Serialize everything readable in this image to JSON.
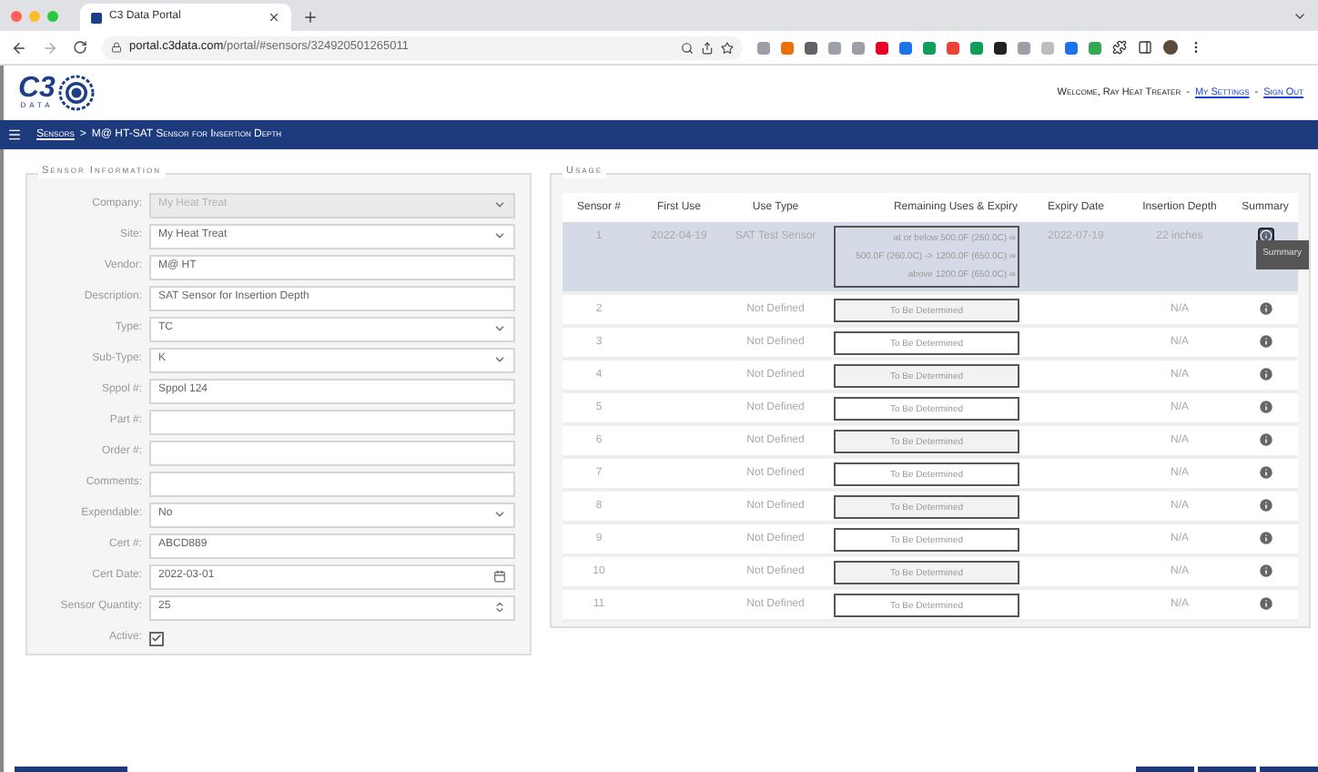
{
  "browser": {
    "tab_title": "C3 Data Portal",
    "url_host": "portal.c3data.com",
    "url_path": "/portal/#sensors/324920501265011"
  },
  "header": {
    "logo_text": "C3",
    "logo_subtext": "DATA",
    "welcome": "Welcome, Ray Heat Treater",
    "separator_1": "-",
    "settings_link": "My Settings",
    "separator_2": "-",
    "signout_link": "Sign Out"
  },
  "nav": {
    "crumb_link": "Sensors",
    "crumb_separator": ">",
    "crumb_current": "M@ HT-SAT Sensor for Insertion Depth"
  },
  "sensor_info": {
    "title": "Sensor Information",
    "fields": [
      {
        "label": "Company:",
        "kind": "select",
        "value": "My Heat Treat",
        "disabled": true
      },
      {
        "label": "Site:",
        "kind": "select",
        "value": "My Heat Treat",
        "disabled": false
      },
      {
        "label": "Vendor:",
        "kind": "text",
        "value": "M@ HT",
        "disabled": false
      },
      {
        "label": "Description:",
        "kind": "text",
        "value": "SAT Sensor for Insertion Depth",
        "disabled": false
      },
      {
        "label": "Type:",
        "kind": "select",
        "value": "TC",
        "disabled": false
      },
      {
        "label": "Sub-Type:",
        "kind": "select",
        "value": "K",
        "disabled": false
      },
      {
        "label": "Sppol #:",
        "kind": "text",
        "value": "Sppol 124",
        "disabled": false
      },
      {
        "label": "Part #:",
        "kind": "text",
        "disabled": false
      },
      {
        "label": "Order #:",
        "kind": "text",
        "disabled": false
      },
      {
        "label": "Comments:",
        "kind": "text",
        "disabled": false
      },
      {
        "label": "Expendable:",
        "kind": "select",
        "value": "No",
        "disabled": false
      },
      {
        "label": "Cert #:",
        "kind": "text",
        "value": "ABCD889",
        "disabled": false
      },
      {
        "label": "Cert Date:",
        "kind": "date",
        "value": "2022-03-01",
        "disabled": false
      },
      {
        "label": "Sensor Quantity:",
        "kind": "number",
        "value": "25",
        "disabled": false
      },
      {
        "label": "Active:",
        "kind": "checkbox",
        "checked": true,
        "disabled": false
      }
    ]
  },
  "usage": {
    "title": "Usage",
    "columns": [
      "Sensor #",
      "First Use",
      "Use Type",
      "Remaining Uses & Expiry",
      "Expiry Date",
      "Insertion Depth",
      "Summary"
    ],
    "rows": [
      {
        "sensor": "1",
        "first_use": "2022-04-19",
        "use_type": "SAT Test Sensor",
        "remaining": [
          "at or below 500.0F (260.0C) ∞",
          "500.0F (260.0C) -> 1200.0F (650.0C) ∞",
          "above 1200.0F (650.0C) ∞"
        ],
        "expiry": "2022-07-19",
        "depth": "22 inches",
        "selected": true
      },
      {
        "sensor": "2",
        "use_type": "Not Defined",
        "remaining": [
          "To Be Determined"
        ],
        "depth": "N/A",
        "selected": false
      },
      {
        "sensor": "3",
        "use_type": "Not Defined",
        "remaining": [
          "To Be Determined"
        ],
        "depth": "N/A",
        "selected": false
      },
      {
        "sensor": "4",
        "use_type": "Not Defined",
        "remaining": [
          "To Be Determined"
        ],
        "depth": "N/A",
        "selected": false
      },
      {
        "sensor": "5",
        "use_type": "Not Defined",
        "remaining": [
          "To Be Determined"
        ],
        "depth": "N/A",
        "selected": false
      },
      {
        "sensor": "6",
        "use_type": "Not Defined",
        "remaining": [
          "To Be Determined"
        ],
        "depth": "N/A",
        "selected": false
      },
      {
        "sensor": "7",
        "use_type": "Not Defined",
        "remaining": [
          "To Be Determined"
        ],
        "depth": "N/A",
        "selected": false
      },
      {
        "sensor": "8",
        "use_type": "Not Defined",
        "remaining": [
          "To Be Determined"
        ],
        "depth": "N/A",
        "selected": false
      },
      {
        "sensor": "9",
        "use_type": "Not Defined",
        "remaining": [
          "To Be Determined"
        ],
        "depth": "N/A",
        "selected": false
      },
      {
        "sensor": "10",
        "use_type": "Not Defined",
        "remaining": [
          "To Be Determined"
        ],
        "depth": "N/A",
        "selected": false
      },
      {
        "sensor": "11",
        "use_type": "Not Defined",
        "remaining": [
          "To Be Determined"
        ],
        "depth": "N/A",
        "selected": false
      }
    ],
    "tooltip": "Summary"
  }
}
